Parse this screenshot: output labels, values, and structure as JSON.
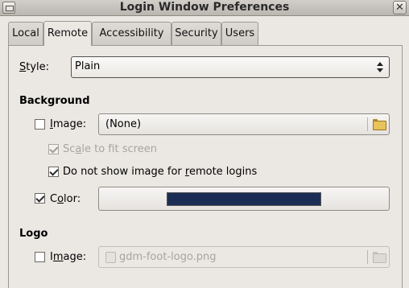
{
  "window": {
    "title": "Login Window Preferences",
    "close_glyph": "✕",
    "system_menu_icon": "window-menu-icon"
  },
  "tabs": [
    {
      "label": "Local",
      "active": false
    },
    {
      "label": "Remote",
      "active": true
    },
    {
      "label": "Accessibility",
      "active": false
    },
    {
      "label": "Security",
      "active": false
    },
    {
      "label": "Users",
      "active": false
    }
  ],
  "style": {
    "label_pre": "",
    "label_mnemonic": "S",
    "label_post": "tyle:",
    "selected": "Plain"
  },
  "background": {
    "heading": "Background",
    "image": {
      "checked": false,
      "label_pre": "",
      "label_mnemonic": "I",
      "label_post": "mage:",
      "value": "(None)",
      "icon": "folder-open-icon"
    },
    "scale_to_fit": {
      "checked": true,
      "enabled": false,
      "label_pre": "Sc",
      "label_mnemonic": "a",
      "label_post": "le to fit screen"
    },
    "no_remote_image": {
      "checked": true,
      "label_pre": "Do not show image for ",
      "label_mnemonic": "r",
      "label_post": "emote logins"
    },
    "color": {
      "checked": true,
      "label_pre": "C",
      "label_mnemonic": "o",
      "label_post": "lor:",
      "swatch": "#1b2d55"
    }
  },
  "logo": {
    "heading": "Logo",
    "image": {
      "checked": false,
      "label_pre": "I",
      "label_mnemonic": "m",
      "label_post": "age:",
      "value": "gdm-foot-logo.png",
      "enabled": false,
      "icon": "folder-open-icon"
    }
  }
}
